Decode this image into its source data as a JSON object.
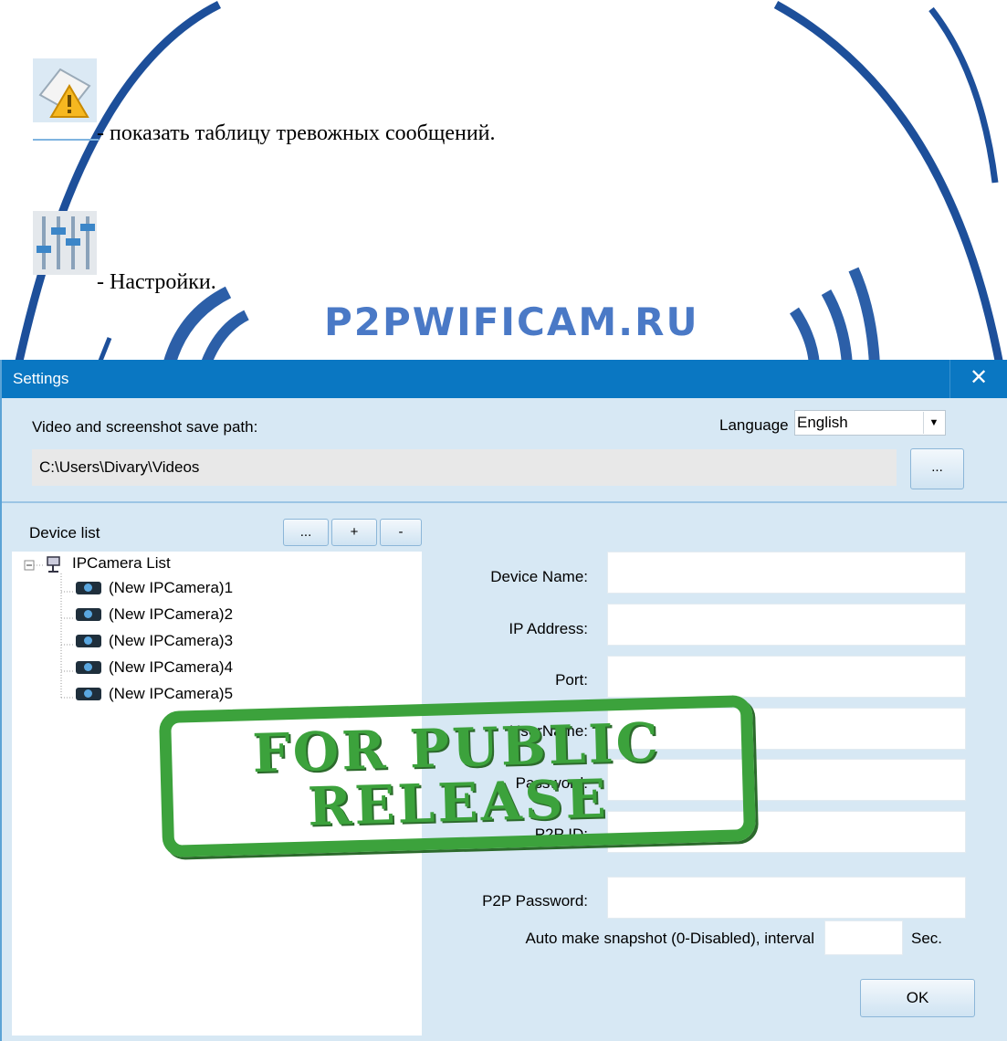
{
  "doc": {
    "alarm_text": "- показать таблицу тревожных сообщений.",
    "settings_text": "- Настройки.",
    "alarm_icon": "alarm-table-icon",
    "settings_icon": "settings-sliders-icon",
    "watermark": "P2PWIFICAM.RU"
  },
  "dialog": {
    "title": "Settings",
    "close": "✕",
    "save_path_label": "Video and screenshot save path:",
    "save_path_value": "C:\\Users\\Divary\\Videos",
    "browse_label": "...",
    "language_label": "Language",
    "language_value": "English",
    "device_list_label": "Device list",
    "device_buttons": [
      "...",
      "+",
      "-"
    ],
    "tree_root": "IPCamera List",
    "tree_items": [
      "(New IPCamera)1",
      "(New IPCamera)2",
      "(New IPCamera)3",
      "(New IPCamera)4",
      "(New IPCamera)5"
    ],
    "fields": {
      "device_name": "Device Name:",
      "ip_address": "IP Address:",
      "port": "Port:",
      "username": "UserName:",
      "password": "Password:",
      "p2p_id": "P2P ID:",
      "p2p_password": "P2P Password:"
    },
    "snapshot_label": "Auto make snapshot (0-Disabled), interval",
    "snapshot_value": "",
    "snapshot_unit": "Sec.",
    "ok_label": "OK"
  },
  "stamp": {
    "line1": "FOR PUBLIC",
    "line2": "RELEASE"
  },
  "colors": {
    "titlebar": "#0a77c2",
    "dialog_bg": "#d7e8f4",
    "stamp": "#3ca23c",
    "watermark": "#4a79c6"
  }
}
